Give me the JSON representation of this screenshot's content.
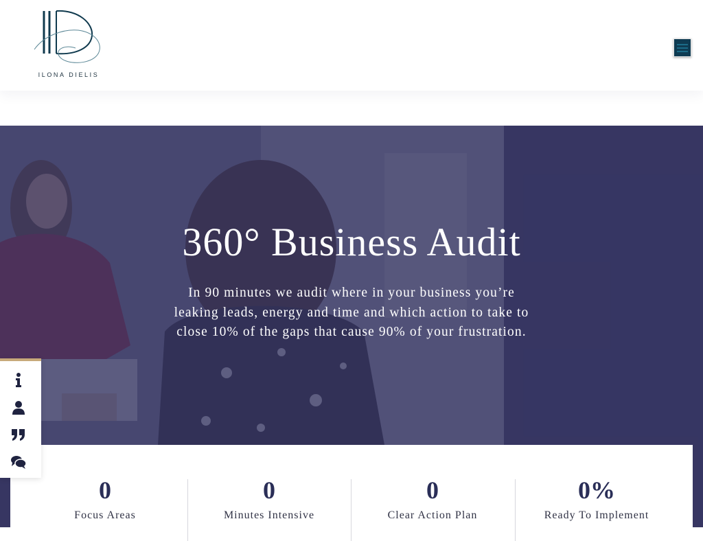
{
  "header": {
    "logo_text": "ILONA DIELIS",
    "logo_monogram": "ID",
    "menu_icon": "hamburger-icon"
  },
  "hero": {
    "title": "360° Business Audit",
    "subtitle": "In 90 minutes we audit where in your business you’re leaking leads, energy and time and which action to take to close 10% of the gaps that cause 90% of your frustration."
  },
  "side_nav": {
    "accent_color": "#c7a97a",
    "items": [
      {
        "icon": "info-icon"
      },
      {
        "icon": "person-icon"
      },
      {
        "icon": "quote-icon"
      },
      {
        "icon": "comments-icon"
      }
    ]
  },
  "stats": [
    {
      "number": "0",
      "label": "Focus Areas"
    },
    {
      "number": "0",
      "label": "Minutes Intensive"
    },
    {
      "number": "0",
      "label": "Clear Action Plan"
    },
    {
      "number": "0%",
      "label": "Ready To Implement"
    }
  ],
  "colors": {
    "brand_navy": "#2a2e57",
    "overlay": "#343462",
    "menu_button": "#0e3b52"
  }
}
